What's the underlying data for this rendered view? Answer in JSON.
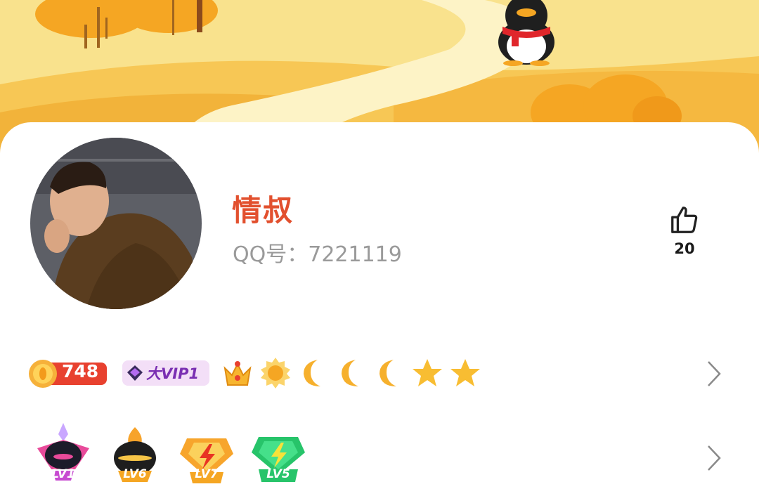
{
  "profile": {
    "nickname": "情叔",
    "qq_label": "QQ号：",
    "qq_number": "7221119"
  },
  "like": {
    "icon": "thumbs-up-icon",
    "count": "20"
  },
  "badges_row1": {
    "coin_value": "748",
    "vip_label": "大VIP1",
    "level_icons": [
      "crown-icon",
      "sun-icon",
      "moon-icon",
      "moon-icon",
      "moon-icon",
      "star-icon",
      "star-icon"
    ]
  },
  "badges_row2": {
    "items": [
      {
        "icon": "lv1-badge-icon",
        "label": "LV1"
      },
      {
        "icon": "lv6-badge-icon",
        "label": "LV6"
      },
      {
        "icon": "lv7-badge-icon",
        "label": "LV7"
      },
      {
        "icon": "lv5-badge-icon",
        "label": "LV5"
      }
    ]
  },
  "colors": {
    "nickname": "#e2502e",
    "hero_bg": "#f8e08a",
    "accent_orange": "#f5a623"
  }
}
